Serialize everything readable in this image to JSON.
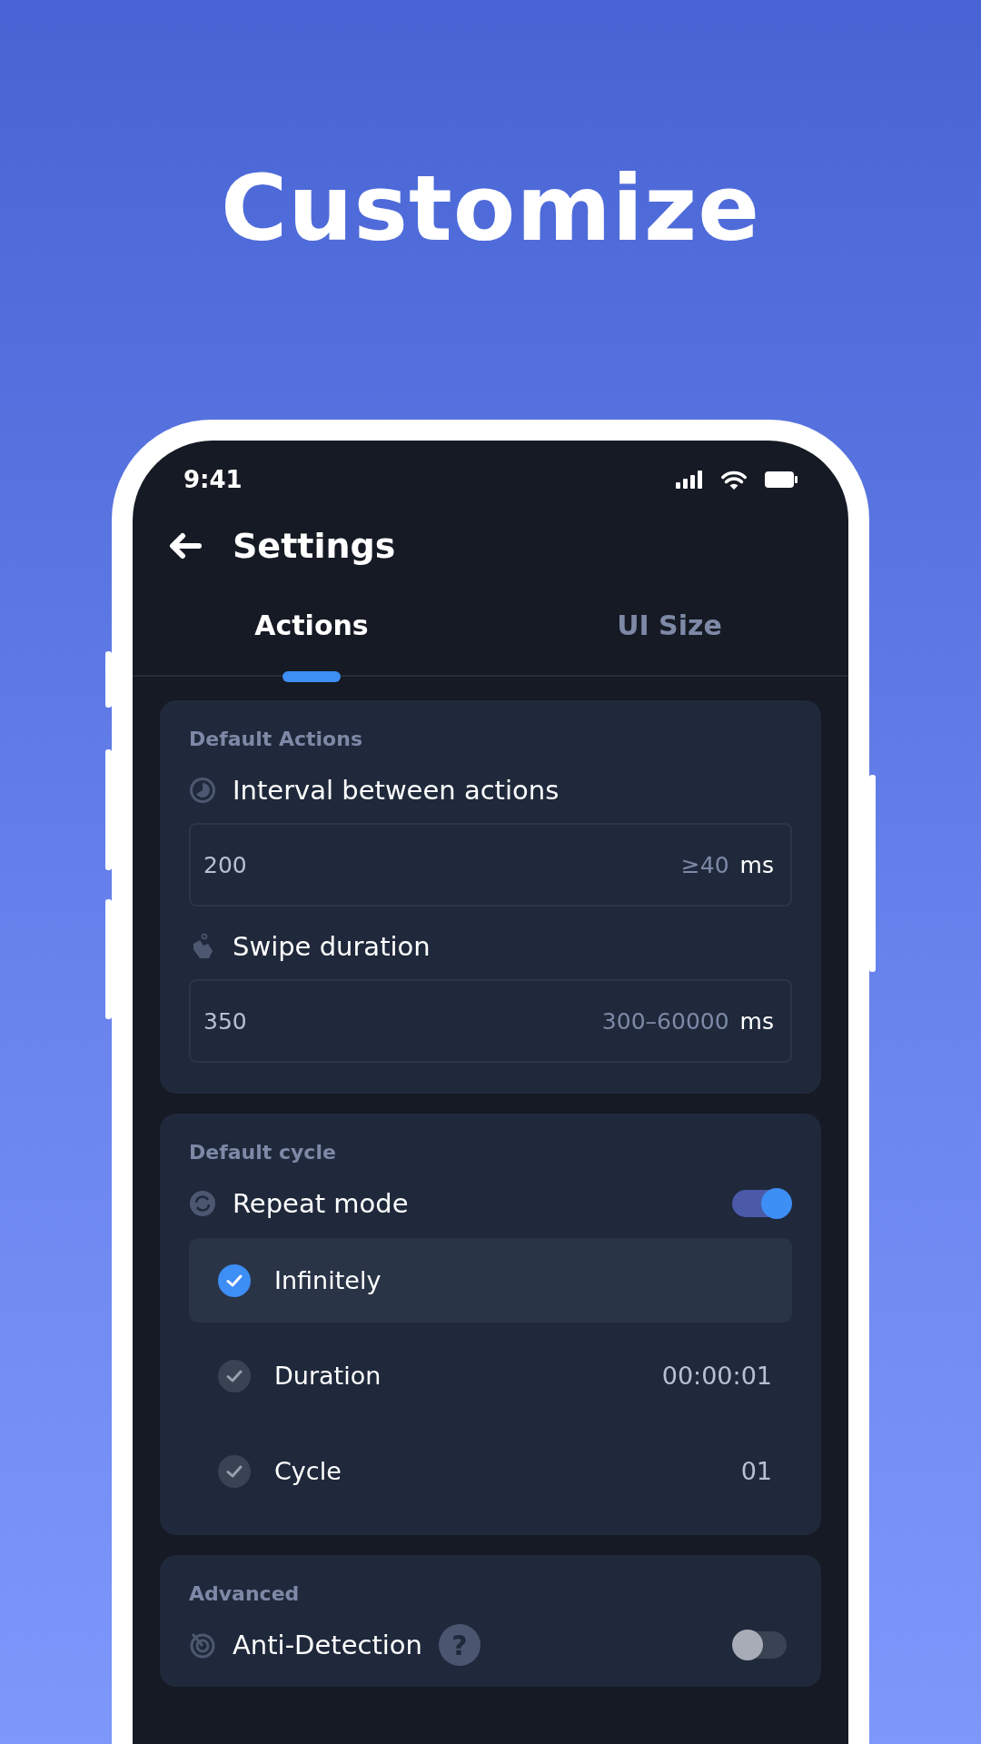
{
  "headline": "Customize",
  "status_bar": {
    "time": "9:41"
  },
  "header": {
    "title": "Settings"
  },
  "tabs": [
    {
      "label": "Actions",
      "selected": true
    },
    {
      "label": "UI Size",
      "selected": false
    }
  ],
  "sections": [
    {
      "title": "Default Actions",
      "rows": [
        {
          "kind": "input",
          "label": "Interval between actions",
          "value": "200",
          "hint": "≥40",
          "unit": "ms"
        },
        {
          "kind": "input",
          "label": "Swipe duration",
          "value": "350",
          "hint": "300–60000",
          "unit": "ms"
        }
      ]
    },
    {
      "title": "Default cycle",
      "rows": [
        {
          "kind": "toggle",
          "label": "Repeat mode",
          "on": true
        }
      ],
      "options": [
        {
          "label": "Infinitely",
          "selected": true
        },
        {
          "label": "Duration",
          "selected": false,
          "value": "00:00:01"
        },
        {
          "label": "Cycle",
          "selected": false,
          "value": "01"
        }
      ]
    },
    {
      "title": "Advanced",
      "rows": [
        {
          "kind": "toggle",
          "label": "Anti-Detection",
          "on": false,
          "help": "?"
        }
      ]
    }
  ]
}
